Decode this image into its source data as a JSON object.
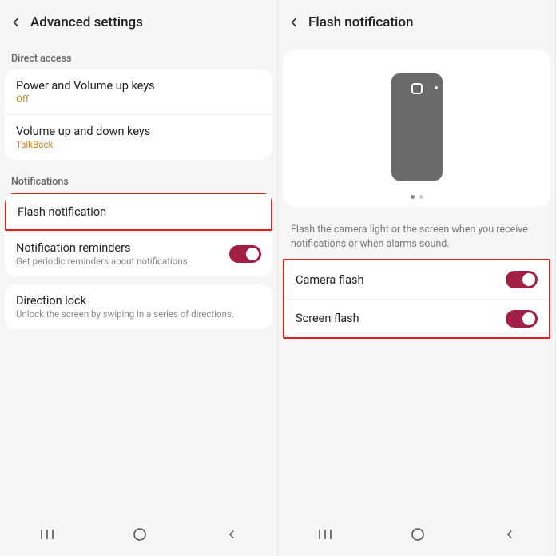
{
  "left": {
    "title": "Advanced settings",
    "section_direct": "Direct access",
    "section_notifications": "Notifications",
    "items": {
      "power_volume": {
        "title": "Power and Volume up keys",
        "status": "Off"
      },
      "volume_updown": {
        "title": "Volume up and down keys",
        "status": "TalkBack"
      },
      "flash_notif": {
        "title": "Flash notification"
      },
      "notif_reminders": {
        "title": "Notification reminders",
        "sub": "Get periodic reminders about notifications."
      },
      "direction_lock": {
        "title": "Direction lock",
        "sub": "Unlock the screen by swiping in a series of directions."
      }
    }
  },
  "right": {
    "title": "Flash notification",
    "info": "Flash the camera light or the screen when you receive notifications or when alarms sound.",
    "items": {
      "camera_flash": {
        "title": "Camera flash"
      },
      "screen_flash": {
        "title": "Screen flash"
      }
    }
  },
  "colors": {
    "accent": "#a12044",
    "highlight": "#d22"
  }
}
